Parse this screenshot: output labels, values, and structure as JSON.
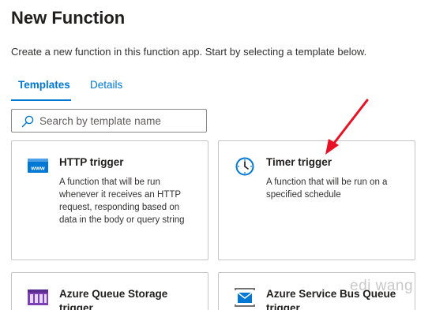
{
  "page": {
    "title": "New Function",
    "subtitle": "Create a new function in this function app. Start by selecting a template below."
  },
  "tabs": [
    {
      "label": "Templates",
      "active": true
    },
    {
      "label": "Details",
      "active": false
    }
  ],
  "search": {
    "placeholder": "Search by template name",
    "icon": "search-icon"
  },
  "templates": [
    {
      "title": "HTTP trigger",
      "description": "A function that will be run whenever it receives an HTTP request, responding based on data in the body or query string",
      "icon": "http-www-icon",
      "icon_label": "www"
    },
    {
      "title": "Timer trigger",
      "description": "A function that will be run on a specified schedule",
      "icon": "clock-icon"
    },
    {
      "title": "Azure Queue Storage trigger",
      "description": "",
      "icon": "queue-storage-icon"
    },
    {
      "title": "Azure Service Bus Queue trigger",
      "description": "",
      "icon": "service-bus-icon"
    }
  ],
  "watermark": "edi wang",
  "colors": {
    "accent": "#0078d4",
    "annotation_arrow": "#e81123",
    "border": "#c8c6c4"
  }
}
